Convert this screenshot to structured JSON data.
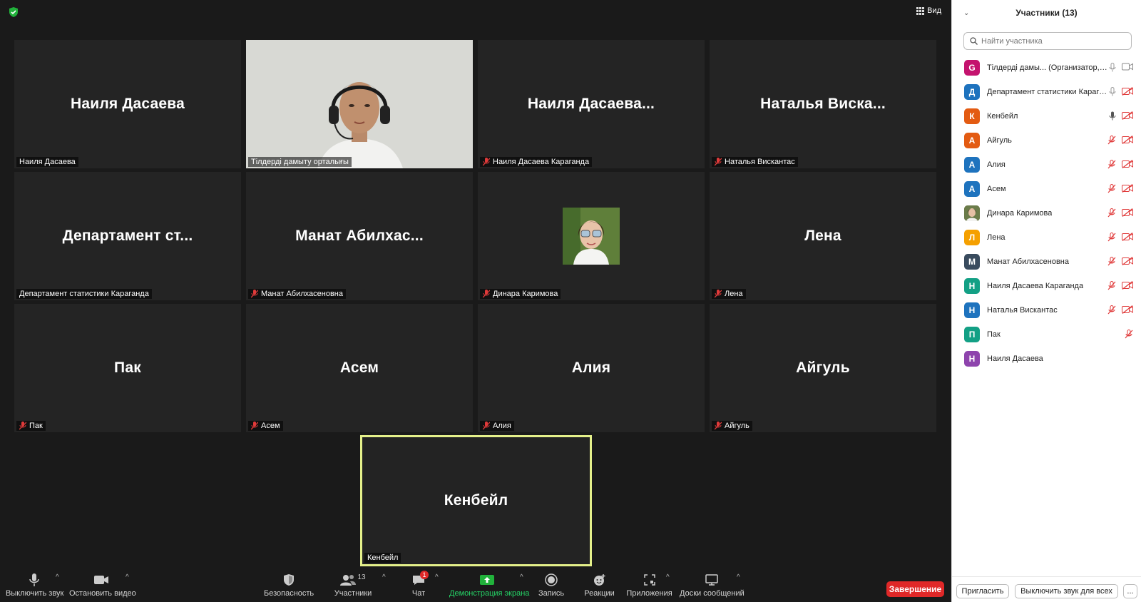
{
  "view_label": "Вид",
  "tiles": [
    {
      "big": "Наиля Дасаева",
      "label": "Наиля Дасаева",
      "muted": false
    },
    {
      "big": "",
      "label": "Тілдерді дамыту орталығы",
      "muted": false
    },
    {
      "big": "Наиля  Дасаева...",
      "label": "Наиля Дасаева Караганда",
      "muted": true
    },
    {
      "big": "Наталья  Виска...",
      "label": "Наталья Вискантас",
      "muted": true
    },
    {
      "big": "Департамент  ст...",
      "label": "Департамент статистики Караганда",
      "muted": false
    },
    {
      "big": "Манат  Абилхас...",
      "label": "Манат Абилхасеновна",
      "muted": true
    },
    {
      "big": "",
      "label": "Динара Каримова",
      "muted": true
    },
    {
      "big": "Лена",
      "label": "Лена",
      "muted": true
    },
    {
      "big": "Пак",
      "label": "Пак",
      "muted": true
    },
    {
      "big": "Асем",
      "label": "Асем",
      "muted": true
    },
    {
      "big": "Алия",
      "label": "Алия",
      "muted": true
    },
    {
      "big": "Айгуль",
      "label": "Айгуль",
      "muted": true
    },
    {
      "big": "Кенбейл",
      "label": "Кенбейл",
      "muted": false
    }
  ],
  "toolbar": {
    "mute": "Выключить звук",
    "video": "Остановить видео",
    "security": "Безопасность",
    "participants": "Участники",
    "participants_count": "13",
    "chat": "Чат",
    "chat_badge": "1",
    "share": "Демонстрация экрана",
    "record": "Запись",
    "reactions": "Реакции",
    "apps": "Приложения",
    "whiteboards": "Доски сообщений",
    "end": "Завершение"
  },
  "sidebar": {
    "title": "Участники (13)",
    "search_placeholder": "Найти участника",
    "participants": [
      {
        "initial": "G",
        "name": "Тілдерді дамы... (Организатор, я)",
        "color": "#c4136e",
        "mic": "on",
        "video": "on"
      },
      {
        "initial": "Д",
        "name": "Департамент статистики Караганда",
        "color": "#1e73be",
        "mic": "on",
        "video": "off"
      },
      {
        "initial": "К",
        "name": "Кенбейл",
        "color": "#e35b12",
        "mic": "on-dark",
        "video": "off"
      },
      {
        "initial": "А",
        "name": "Айгуль",
        "color": "#e35b12",
        "mic": "off",
        "video": "off"
      },
      {
        "initial": "А",
        "name": "Алия",
        "color": "#1e73be",
        "mic": "off",
        "video": "off"
      },
      {
        "initial": "А",
        "name": "Асем",
        "color": "#1e73be",
        "mic": "off",
        "video": "off"
      },
      {
        "initial": "",
        "name": "Динара Каримова",
        "color": "#8a6a4a",
        "mic": "off",
        "video": "off"
      },
      {
        "initial": "Л",
        "name": "Лена",
        "color": "#f5a000",
        "mic": "off",
        "video": "off"
      },
      {
        "initial": "М",
        "name": "Манат Абилхасеновна",
        "color": "#394b5e",
        "mic": "off",
        "video": "off"
      },
      {
        "initial": "Н",
        "name": "Наиля Дасаева Караганда",
        "color": "#13a085",
        "mic": "off",
        "video": "off"
      },
      {
        "initial": "Н",
        "name": "Наталья Вискантас",
        "color": "#1e73be",
        "mic": "off",
        "video": "off"
      },
      {
        "initial": "П",
        "name": "Пак",
        "color": "#13a085",
        "mic": "off",
        "video": "none"
      },
      {
        "initial": "Н",
        "name": "Наиля Дасаева",
        "color": "#8e44ad",
        "mic": "none",
        "video": "none"
      }
    ],
    "invite": "Пригласить",
    "mute_all": "Выключить звук для всех",
    "more": "..."
  }
}
